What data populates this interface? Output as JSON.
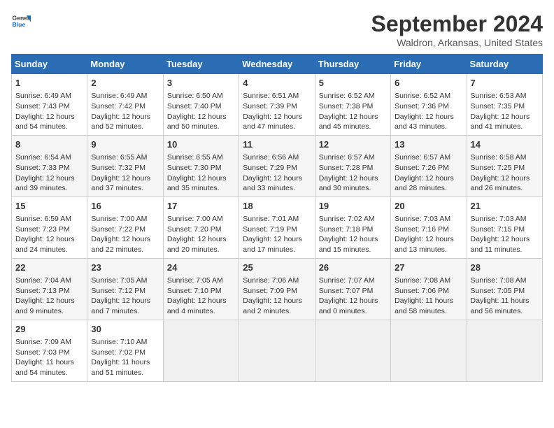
{
  "header": {
    "logo_line1": "General",
    "logo_line2": "Blue",
    "title": "September 2024",
    "subtitle": "Waldron, Arkansas, United States"
  },
  "calendar": {
    "headers": [
      "Sunday",
      "Monday",
      "Tuesday",
      "Wednesday",
      "Thursday",
      "Friday",
      "Saturday"
    ],
    "weeks": [
      [
        {
          "empty": true
        },
        {
          "empty": true
        },
        {
          "empty": true
        },
        {
          "empty": true
        },
        {
          "day": "5",
          "sunrise": "Sunrise: 6:52 AM",
          "sunset": "Sunset: 7:38 PM",
          "daylight": "Daylight: 12 hours and 45 minutes."
        },
        {
          "day": "6",
          "sunrise": "Sunrise: 6:52 AM",
          "sunset": "Sunset: 7:36 PM",
          "daylight": "Daylight: 12 hours and 43 minutes."
        },
        {
          "day": "7",
          "sunrise": "Sunrise: 6:53 AM",
          "sunset": "Sunset: 7:35 PM",
          "daylight": "Daylight: 12 hours and 41 minutes."
        }
      ],
      [
        {
          "empty": true
        },
        {
          "day": "2",
          "sunrise": "Sunrise: 6:49 AM",
          "sunset": "Sunset: 7:42 PM",
          "daylight": "Daylight: 12 hours and 52 minutes."
        },
        {
          "day": "3",
          "sunrise": "Sunrise: 6:50 AM",
          "sunset": "Sunset: 7:40 PM",
          "daylight": "Daylight: 12 hours and 50 minutes."
        },
        {
          "day": "4",
          "sunrise": "Sunrise: 6:51 AM",
          "sunset": "Sunset: 7:39 PM",
          "daylight": "Daylight: 12 hours and 47 minutes."
        },
        {
          "day": "5",
          "sunrise": "Sunrise: 6:52 AM",
          "sunset": "Sunset: 7:38 PM",
          "daylight": "Daylight: 12 hours and 45 minutes."
        },
        {
          "day": "6",
          "sunrise": "Sunrise: 6:52 AM",
          "sunset": "Sunset: 7:36 PM",
          "daylight": "Daylight: 12 hours and 43 minutes."
        },
        {
          "day": "7",
          "sunrise": "Sunrise: 6:53 AM",
          "sunset": "Sunset: 7:35 PM",
          "daylight": "Daylight: 12 hours and 41 minutes."
        }
      ],
      [
        {
          "day": "1",
          "sunrise": "Sunrise: 6:49 AM",
          "sunset": "Sunset: 7:43 PM",
          "daylight": "Daylight: 12 hours and 54 minutes."
        },
        {
          "day": "2",
          "sunrise": "Sunrise: 6:49 AM",
          "sunset": "Sunset: 7:42 PM",
          "daylight": "Daylight: 12 hours and 52 minutes."
        },
        {
          "day": "3",
          "sunrise": "Sunrise: 6:50 AM",
          "sunset": "Sunset: 7:40 PM",
          "daylight": "Daylight: 12 hours and 50 minutes."
        },
        {
          "day": "4",
          "sunrise": "Sunrise: 6:51 AM",
          "sunset": "Sunset: 7:39 PM",
          "daylight": "Daylight: 12 hours and 47 minutes."
        },
        {
          "day": "5",
          "sunrise": "Sunrise: 6:52 AM",
          "sunset": "Sunset: 7:38 PM",
          "daylight": "Daylight: 12 hours and 45 minutes."
        },
        {
          "day": "6",
          "sunrise": "Sunrise: 6:52 AM",
          "sunset": "Sunset: 7:36 PM",
          "daylight": "Daylight: 12 hours and 43 minutes."
        },
        {
          "day": "7",
          "sunrise": "Sunrise: 6:53 AM",
          "sunset": "Sunset: 7:35 PM",
          "daylight": "Daylight: 12 hours and 41 minutes."
        }
      ],
      [
        {
          "day": "8",
          "sunrise": "Sunrise: 6:54 AM",
          "sunset": "Sunset: 7:33 PM",
          "daylight": "Daylight: 12 hours and 39 minutes."
        },
        {
          "day": "9",
          "sunrise": "Sunrise: 6:55 AM",
          "sunset": "Sunset: 7:32 PM",
          "daylight": "Daylight: 12 hours and 37 minutes."
        },
        {
          "day": "10",
          "sunrise": "Sunrise: 6:55 AM",
          "sunset": "Sunset: 7:30 PM",
          "daylight": "Daylight: 12 hours and 35 minutes."
        },
        {
          "day": "11",
          "sunrise": "Sunrise: 6:56 AM",
          "sunset": "Sunset: 7:29 PM",
          "daylight": "Daylight: 12 hours and 33 minutes."
        },
        {
          "day": "12",
          "sunrise": "Sunrise: 6:57 AM",
          "sunset": "Sunset: 7:28 PM",
          "daylight": "Daylight: 12 hours and 30 minutes."
        },
        {
          "day": "13",
          "sunrise": "Sunrise: 6:57 AM",
          "sunset": "Sunset: 7:26 PM",
          "daylight": "Daylight: 12 hours and 28 minutes."
        },
        {
          "day": "14",
          "sunrise": "Sunrise: 6:58 AM",
          "sunset": "Sunset: 7:25 PM",
          "daylight": "Daylight: 12 hours and 26 minutes."
        }
      ],
      [
        {
          "day": "15",
          "sunrise": "Sunrise: 6:59 AM",
          "sunset": "Sunset: 7:23 PM",
          "daylight": "Daylight: 12 hours and 24 minutes."
        },
        {
          "day": "16",
          "sunrise": "Sunrise: 7:00 AM",
          "sunset": "Sunset: 7:22 PM",
          "daylight": "Daylight: 12 hours and 22 minutes."
        },
        {
          "day": "17",
          "sunrise": "Sunrise: 7:00 AM",
          "sunset": "Sunset: 7:20 PM",
          "daylight": "Daylight: 12 hours and 20 minutes."
        },
        {
          "day": "18",
          "sunrise": "Sunrise: 7:01 AM",
          "sunset": "Sunset: 7:19 PM",
          "daylight": "Daylight: 12 hours and 17 minutes."
        },
        {
          "day": "19",
          "sunrise": "Sunrise: 7:02 AM",
          "sunset": "Sunset: 7:18 PM",
          "daylight": "Daylight: 12 hours and 15 minutes."
        },
        {
          "day": "20",
          "sunrise": "Sunrise: 7:03 AM",
          "sunset": "Sunset: 7:16 PM",
          "daylight": "Daylight: 12 hours and 13 minutes."
        },
        {
          "day": "21",
          "sunrise": "Sunrise: 7:03 AM",
          "sunset": "Sunset: 7:15 PM",
          "daylight": "Daylight: 12 hours and 11 minutes."
        }
      ],
      [
        {
          "day": "22",
          "sunrise": "Sunrise: 7:04 AM",
          "sunset": "Sunset: 7:13 PM",
          "daylight": "Daylight: 12 hours and 9 minutes."
        },
        {
          "day": "23",
          "sunrise": "Sunrise: 7:05 AM",
          "sunset": "Sunset: 7:12 PM",
          "daylight": "Daylight: 12 hours and 7 minutes."
        },
        {
          "day": "24",
          "sunrise": "Sunrise: 7:05 AM",
          "sunset": "Sunset: 7:10 PM",
          "daylight": "Daylight: 12 hours and 4 minutes."
        },
        {
          "day": "25",
          "sunrise": "Sunrise: 7:06 AM",
          "sunset": "Sunset: 7:09 PM",
          "daylight": "Daylight: 12 hours and 2 minutes."
        },
        {
          "day": "26",
          "sunrise": "Sunrise: 7:07 AM",
          "sunset": "Sunset: 7:07 PM",
          "daylight": "Daylight: 12 hours and 0 minutes."
        },
        {
          "day": "27",
          "sunrise": "Sunrise: 7:08 AM",
          "sunset": "Sunset: 7:06 PM",
          "daylight": "Daylight: 11 hours and 58 minutes."
        },
        {
          "day": "28",
          "sunrise": "Sunrise: 7:08 AM",
          "sunset": "Sunset: 7:05 PM",
          "daylight": "Daylight: 11 hours and 56 minutes."
        }
      ],
      [
        {
          "day": "29",
          "sunrise": "Sunrise: 7:09 AM",
          "sunset": "Sunset: 7:03 PM",
          "daylight": "Daylight: 11 hours and 54 minutes."
        },
        {
          "day": "30",
          "sunrise": "Sunrise: 7:10 AM",
          "sunset": "Sunset: 7:02 PM",
          "daylight": "Daylight: 11 hours and 51 minutes."
        },
        {
          "empty": true
        },
        {
          "empty": true
        },
        {
          "empty": true
        },
        {
          "empty": true
        },
        {
          "empty": true
        }
      ]
    ]
  }
}
